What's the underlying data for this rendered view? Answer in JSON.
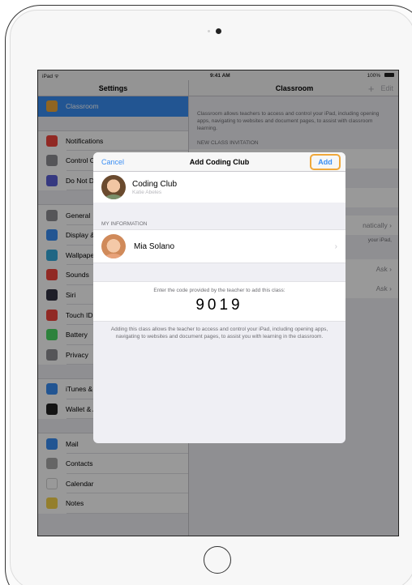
{
  "status_bar": {
    "left": "iPad ᯤ",
    "time": "9:41 AM",
    "battery": "100%"
  },
  "sidebar": {
    "title": "Settings",
    "groups": [
      [
        {
          "label": "Classroom",
          "icon": "classroom-icon",
          "color": "#f0a83a",
          "selected": true
        }
      ],
      [
        {
          "label": "Notifications",
          "icon": "notifications-icon",
          "color": "#f2453d"
        },
        {
          "label": "Control Center",
          "icon": "control-center-icon",
          "color": "#8e8e93"
        },
        {
          "label": "Do Not Disturb",
          "icon": "moon-icon",
          "color": "#5b5fd6"
        }
      ],
      [
        {
          "label": "General",
          "icon": "gear-icon",
          "color": "#8e8e93"
        },
        {
          "label": "Display & Brightness",
          "icon": "display-icon",
          "color": "#3a8ef3"
        },
        {
          "label": "Wallpaper",
          "icon": "wallpaper-icon",
          "color": "#34aadc"
        },
        {
          "label": "Sounds",
          "icon": "sounds-icon",
          "color": "#f2453d"
        },
        {
          "label": "Siri",
          "icon": "siri-icon",
          "color": "#333344"
        },
        {
          "label": "Touch ID & Passcode",
          "icon": "fingerprint-icon",
          "color": "#f2453d"
        },
        {
          "label": "Battery",
          "icon": "battery-icon",
          "color": "#4cd964"
        },
        {
          "label": "Privacy",
          "icon": "privacy-icon",
          "color": "#8e8e93"
        }
      ],
      [
        {
          "label": "iTunes & App Store",
          "icon": "app-store-icon",
          "color": "#3a8ef3"
        },
        {
          "label": "Wallet & Apple Pay",
          "icon": "wallet-icon",
          "color": "#222222"
        }
      ],
      [
        {
          "label": "Mail",
          "icon": "mail-icon",
          "color": "#3a8ef3"
        },
        {
          "label": "Contacts",
          "icon": "contacts-icon",
          "color": "#a8a8a8"
        },
        {
          "label": "Calendar",
          "icon": "calendar-icon",
          "color": "#ffffff"
        },
        {
          "label": "Notes",
          "icon": "notes-icon",
          "color": "#f7d44c"
        }
      ]
    ]
  },
  "detail": {
    "title": "Classroom",
    "plus": "+",
    "edit": "Edit",
    "description": "Classroom allows teachers to access and control your iPad, including opening apps, navigating to websites and document pages, to assist with classroom learning.",
    "section": "NEW CLASS INVITATION",
    "row_value_1": "natically",
    "row_value_2": "your iPad,",
    "ask_1": "Ask",
    "ask_2": "Ask"
  },
  "modal": {
    "cancel": "Cancel",
    "title": "Add Coding Club",
    "add": "Add",
    "club_name": "Coding Club",
    "club_teacher": "Katie Abeles",
    "my_info_label": "MY INFORMATION",
    "my_name": "Mia Solano",
    "code_prompt": "Enter the code provided by the teacher to add this class:",
    "code": "9019",
    "footer": "Adding this class allows the teacher to access and control your iPad, including opening apps, navigating to websites and document pages, to assist you with learning in the classroom."
  }
}
